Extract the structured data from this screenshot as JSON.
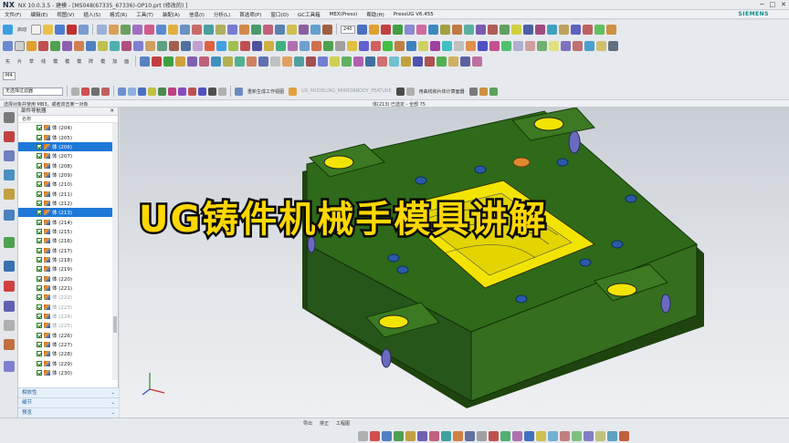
{
  "titlebar": {
    "logo": "NX",
    "title": "NX 10.0.3.5 - 建模 - [MS048(67335_67336)-OP10.prt  (修改的)   ]",
    "minimize": "─",
    "maximize": "□",
    "close": "✕"
  },
  "menubar": {
    "items": [
      "文件(F)",
      "编辑(E)",
      "视图(V)",
      "插入(S)",
      "格式(R)",
      "工具(T)",
      "装配(A)",
      "信息(I)",
      "分析(L)",
      "首选项(P)",
      "窗口(O)",
      "GC工具箱",
      "MEX(Press)",
      "帮助(H)",
      "PressUG V6.455"
    ],
    "brand": "SIEMENS"
  },
  "toolbar1": {
    "start_label": "启动",
    "dropdown_value": "240"
  },
  "toolbar3": {
    "labels": [
      "实",
      "片",
      "草",
      "线",
      "模",
      "模",
      "模",
      "阵",
      "模",
      "加",
      "面"
    ]
  },
  "toolbar4": {
    "layer_label": "M4"
  },
  "filterbar": {
    "filter_value": "无选择过滤器",
    "regen_label": "重新生成工作视图",
    "feature_label": "UG_MODELING_MIRRORBODY_FEATURE",
    "curve_label": "用曲线和片体计算面器"
  },
  "status": {
    "prompt": "选择对象并使用 MB3，或者双击某一对象",
    "selection": "体(213) 已选定 - 全部 75"
  },
  "navigator": {
    "title": "部件导航器",
    "column": "名称",
    "rows": [
      {
        "label": "体 (204)",
        "state": ""
      },
      {
        "label": "体 (205)",
        "state": ""
      },
      {
        "label": "体 (206)",
        "state": "sel"
      },
      {
        "label": "体 (207)",
        "state": ""
      },
      {
        "label": "体 (208)",
        "state": ""
      },
      {
        "label": "体 (209)",
        "state": ""
      },
      {
        "label": "体 (210)",
        "state": ""
      },
      {
        "label": "体 (211)",
        "state": ""
      },
      {
        "label": "体 (212)",
        "state": ""
      },
      {
        "label": "体 (213)",
        "state": "sel"
      },
      {
        "label": "体 (214)",
        "state": ""
      },
      {
        "label": "体 (215)",
        "state": ""
      },
      {
        "label": "体 (216)",
        "state": ""
      },
      {
        "label": "体 (217)",
        "state": ""
      },
      {
        "label": "体 (218)",
        "state": ""
      },
      {
        "label": "体 (219)",
        "state": ""
      },
      {
        "label": "体 (220)",
        "state": ""
      },
      {
        "label": "体 (221)",
        "state": ""
      },
      {
        "label": "体 (222)",
        "state": "dim"
      },
      {
        "label": "体 (223)",
        "state": "dim"
      },
      {
        "label": "体 (224)",
        "state": "dim"
      },
      {
        "label": "体 (225)",
        "state": "dim"
      },
      {
        "label": "体 (226)",
        "state": ""
      },
      {
        "label": "体 (227)",
        "state": ""
      },
      {
        "label": "体 (228)",
        "state": ""
      },
      {
        "label": "体 (229)",
        "state": ""
      },
      {
        "label": "体 (230)",
        "state": ""
      }
    ],
    "sections": [
      "相依性",
      "细节",
      "预览"
    ]
  },
  "overlay": {
    "title": "UG铸件机械手模具讲解"
  },
  "bottom": {
    "tabs": [
      "导出",
      "排正",
      "工程图"
    ]
  },
  "colors": {
    "mold_green": "#2e6a1a",
    "plate_yellow": "#f2e400",
    "bolt_blue": "#2a5aa8",
    "selection_blue": "#1e78d8",
    "overlay_text": "#ffd800"
  }
}
